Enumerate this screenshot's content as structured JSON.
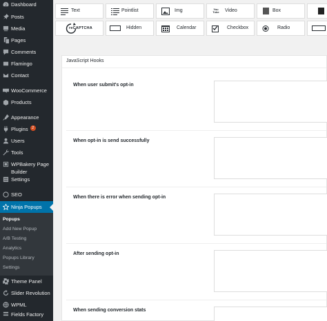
{
  "sidebar": {
    "items": [
      {
        "label": "Dashboard",
        "icon": "dashboard-icon"
      },
      {
        "label": "Posts",
        "icon": "pin-icon"
      },
      {
        "label": "Media",
        "icon": "media-icon"
      },
      {
        "label": "Pages",
        "icon": "pages-icon"
      },
      {
        "label": "Comments",
        "icon": "comments-icon"
      },
      {
        "label": "Flamingo",
        "icon": "flamingo-icon"
      },
      {
        "label": "Contact",
        "icon": "contact-icon"
      },
      {
        "label": "WooCommerce",
        "icon": "woocommerce-icon"
      },
      {
        "label": "Products",
        "icon": "products-icon"
      },
      {
        "label": "Appearance",
        "icon": "appearance-icon"
      },
      {
        "label": "Plugins",
        "icon": "plugins-icon",
        "badge": "2"
      },
      {
        "label": "Users",
        "icon": "users-icon"
      },
      {
        "label": "Tools",
        "icon": "tools-icon"
      },
      {
        "label": "WPBakery Page Builder",
        "icon": "wpbakery-icon"
      },
      {
        "label": "Settings",
        "icon": "settings-icon"
      },
      {
        "label": "SEO",
        "icon": "seo-icon"
      },
      {
        "label": "Ninja Popups",
        "icon": "star-icon"
      },
      {
        "label": "Theme Panel",
        "icon": "gear-icon"
      },
      {
        "label": "Slider Revolution",
        "icon": "refresh-icon"
      },
      {
        "label": "WPML",
        "icon": "wpml-icon"
      },
      {
        "label": "Fields Factory",
        "icon": "fields-icon"
      }
    ],
    "submenu": [
      "Popups",
      "Add New Popup",
      "A/B Testing",
      "Analytics",
      "Popups Library",
      "Settings"
    ]
  },
  "toolbar": {
    "row1": [
      {
        "label": "Text",
        "icon": "text-lines-icon"
      },
      {
        "label": "Pointlist",
        "icon": "list-icon"
      },
      {
        "label": "Img",
        "icon": "image-icon"
      },
      {
        "label": "Video",
        "icon": "youtube-icon",
        "icon_text": "You Tube"
      },
      {
        "label": "Box",
        "icon": "box-icon"
      }
    ],
    "row2": [
      {
        "label": "",
        "icon": "recaptcha-icon",
        "icon_text": "reCAPTCHA"
      },
      {
        "label": "Hidden",
        "icon": "hidden-field-icon"
      },
      {
        "label": "Calendar",
        "icon": "calendar-icon"
      },
      {
        "label": "Checkbox",
        "icon": "checkbox-icon"
      },
      {
        "label": "Radio",
        "icon": "radio-icon"
      }
    ]
  },
  "panel": {
    "title": "JavaScript Hooks",
    "hooks": [
      "When user submit's opt-in",
      "When opt-in is send successfully",
      "When there is error when sending opt-in",
      "After sending opt-in",
      "When sending conversion stats"
    ]
  },
  "colors": {
    "sidebar_bg": "#23282d",
    "active_bg": "#0073aa",
    "badge": "#d54e21"
  }
}
